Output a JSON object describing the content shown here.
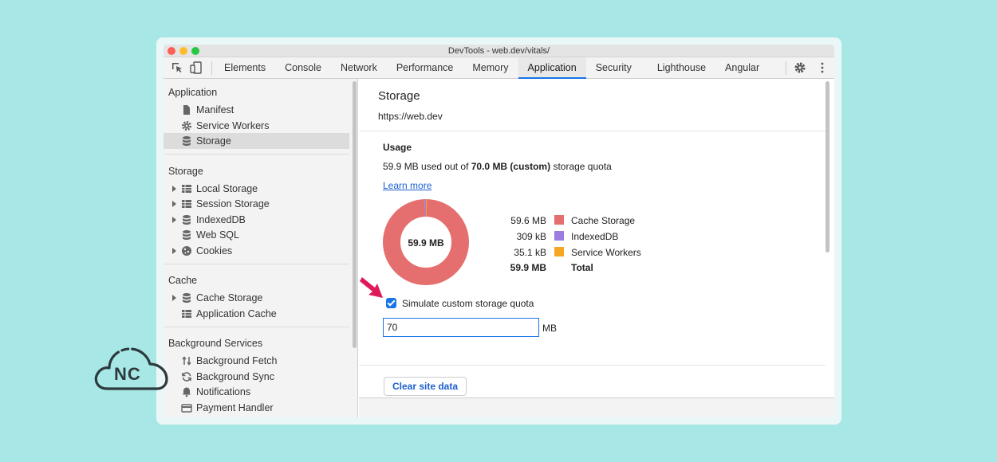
{
  "window": {
    "title": "DevTools - web.dev/vitals/"
  },
  "toolbar": {
    "tabs": [
      {
        "label": "Elements"
      },
      {
        "label": "Console"
      },
      {
        "label": "Network"
      },
      {
        "label": "Performance"
      },
      {
        "label": "Memory"
      },
      {
        "label": "Application",
        "active": true
      },
      {
        "label": "Security"
      },
      {
        "label": "Lighthouse"
      },
      {
        "label": "Angular"
      }
    ],
    "icons": [
      "inspect-element-icon",
      "device-toolbar-icon",
      "settings-gear-icon",
      "more-options-icon"
    ]
  },
  "sidebar": {
    "groups": [
      {
        "label": "Application",
        "items": [
          {
            "label": "Manifest",
            "icon": "file-icon"
          },
          {
            "label": "Service Workers",
            "icon": "gear-icon"
          },
          {
            "label": "Storage",
            "icon": "database-icon",
            "selected": true
          }
        ]
      },
      {
        "label": "Storage",
        "items": [
          {
            "label": "Local Storage",
            "icon": "grid-icon",
            "expandable": true
          },
          {
            "label": "Session Storage",
            "icon": "grid-icon",
            "expandable": true
          },
          {
            "label": "IndexedDB",
            "icon": "database-icon",
            "expandable": true
          },
          {
            "label": "Web SQL",
            "icon": "database-icon"
          },
          {
            "label": "Cookies",
            "icon": "cookie-icon",
            "expandable": true
          }
        ]
      },
      {
        "label": "Cache",
        "items": [
          {
            "label": "Cache Storage",
            "icon": "database-icon",
            "expandable": true
          },
          {
            "label": "Application Cache",
            "icon": "grid-icon"
          }
        ]
      },
      {
        "label": "Background Services",
        "items": [
          {
            "label": "Background Fetch",
            "icon": "up-down-arrows-icon"
          },
          {
            "label": "Background Sync",
            "icon": "sync-icon"
          },
          {
            "label": "Notifications",
            "icon": "bell-icon"
          },
          {
            "label": "Payment Handler",
            "icon": "card-icon"
          }
        ]
      }
    ]
  },
  "main": {
    "title": "Storage",
    "origin": "https://web.dev",
    "usage": {
      "heading": "Usage",
      "used": "59.9 MB",
      "text_before": " used out of ",
      "quota": "70.0 MB (custom)",
      "text_after": " storage quota",
      "learn_more": "Learn more"
    },
    "donut_center": "59.9 MB",
    "legend": [
      {
        "size": "59.6 MB",
        "name": "Cache Storage",
        "color": "#e56f6f"
      },
      {
        "size": "309 kB",
        "name": "IndexedDB",
        "color": "#9c7ce0"
      },
      {
        "size": "35.1 kB",
        "name": "Service Workers",
        "color": "#f5a623"
      }
    ],
    "total": {
      "size": "59.9 MB",
      "name": "Total"
    },
    "simulate": {
      "label": "Simulate custom storage quota",
      "checked": true
    },
    "quota_input": {
      "value": "70",
      "unit": "MB"
    },
    "clear_button": "Clear site data"
  },
  "chart_data": {
    "type": "pie",
    "categories": [
      "Cache Storage",
      "IndexedDB",
      "Service Workers"
    ],
    "values": [
      59.6,
      0.309,
      0.0351
    ],
    "units": "MB"
  },
  "logo": {
    "text": "NC"
  }
}
